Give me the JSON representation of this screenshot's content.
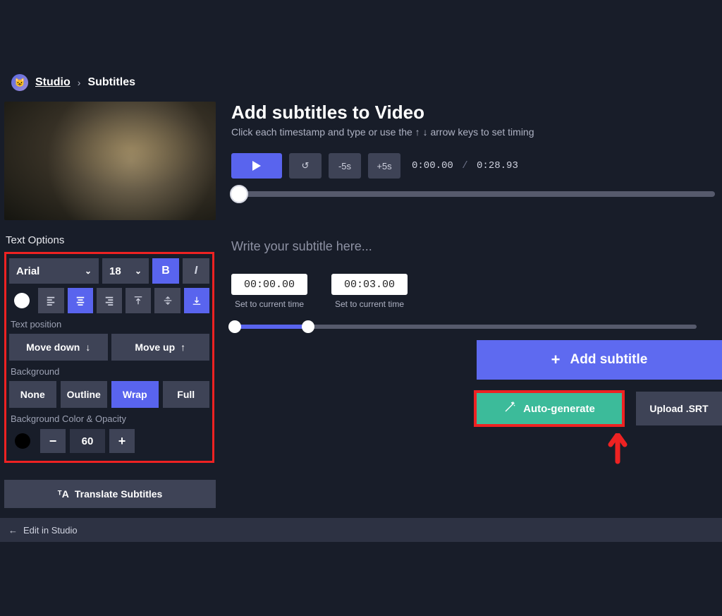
{
  "breadcrumb": {
    "studio": "Studio",
    "sep": "›",
    "current": "Subtitles"
  },
  "sidebar": {
    "text_options_label": "Text Options",
    "font": "Arial",
    "font_size": "18",
    "bold": "B",
    "italic": "I",
    "text_position_label": "Text position",
    "move_down": "Move down",
    "move_up": "Move up",
    "background_label": "Background",
    "bg_none": "None",
    "bg_outline": "Outline",
    "bg_wrap": "Wrap",
    "bg_full": "Full",
    "bg_color_opacity_label": "Background Color & Opacity",
    "minus": "−",
    "plus": "+",
    "opacity_value": "60",
    "translate": "Translate Subtitles"
  },
  "content": {
    "title": "Add subtitles to Video",
    "subtitle": "Click each timestamp and type or use the ↑ ↓ arrow keys to set timing",
    "rewind": "↺",
    "minus5": "-5s",
    "plus5": "+5s",
    "current_time": "0:00.00",
    "sep": "/",
    "total_time": "0:28.93",
    "subtitle_placeholder": "Write your subtitle here...",
    "ts_start": "00:00.00",
    "ts_end": "00:03.00",
    "ts_set_label": "Set to current time",
    "add_icon": "+",
    "add_subtitle": "Add subtitle",
    "auto_generate": "Auto-generate",
    "upload_srt": "Upload .SRT"
  },
  "footer": {
    "back": "←",
    "edit_in_studio": "Edit in Studio"
  }
}
